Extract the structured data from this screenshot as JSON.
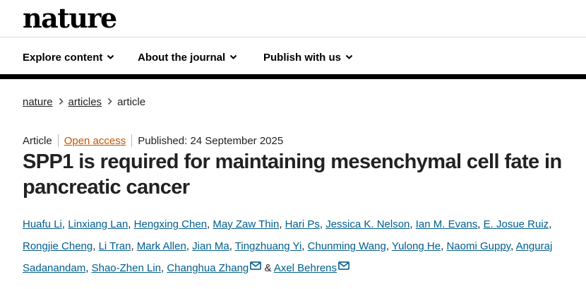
{
  "site": {
    "logo": "nature"
  },
  "nav": {
    "items": [
      {
        "label": "Explore content"
      },
      {
        "label": "About the journal"
      },
      {
        "label": "Publish with us"
      }
    ]
  },
  "breadcrumb": {
    "items": [
      {
        "label": "nature"
      },
      {
        "label": "articles"
      }
    ],
    "current": "article"
  },
  "article": {
    "type": "Article",
    "access": "Open access",
    "published": "Published: 24 September 2025",
    "title": "SPP1 is required for maintaining mesenchymal cell fate in pancreatic cancer",
    "authors": [
      "Huafu Li",
      "Linxiang Lan",
      "Hengxing Chen",
      "May Zaw Thin",
      "Hari Ps",
      "Jessica K. Nelson",
      "Ian M. Evans",
      "E. Josue Ruiz",
      "Rongjie Cheng",
      "Li Tran",
      "Mark Allen",
      "Jian Ma",
      "Tingzhuang Yi",
      "Chunming Wang",
      "Yulong He",
      "Naomi Guppy",
      "Anguraj Sadanandam",
      "Shao-Zhen Lin",
      "Changhua Zhang",
      "Axel Behrens"
    ],
    "author_separator": ",",
    "author_and": "&"
  },
  "colors": {
    "link": "#025e8d",
    "open_access": "#c65301",
    "text": "#222222"
  },
  "icons": {
    "nav_chevron": "chevron-down-icon",
    "breadcrumb_separator": "chevron-right-icon",
    "author_email": "mail-icon"
  }
}
